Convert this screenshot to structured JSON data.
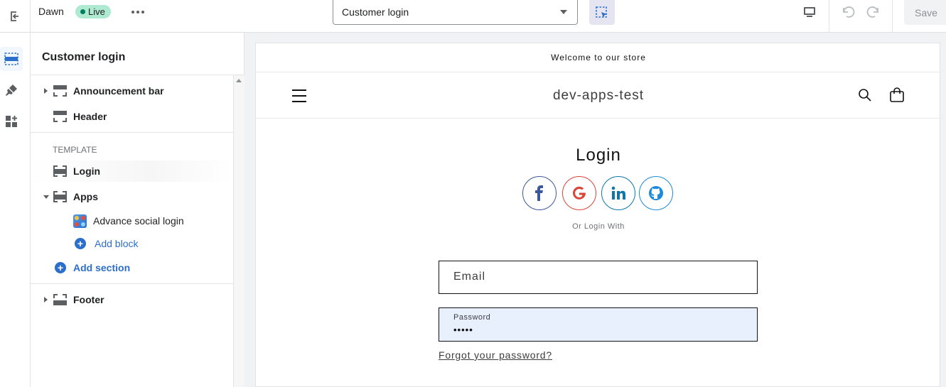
{
  "topbar": {
    "theme_name": "Dawn",
    "live_label": "Live",
    "page_select": "Customer login",
    "save_label": "Save"
  },
  "sidebar": {
    "title": "Customer login",
    "header_group": [
      {
        "label": "Announcement bar",
        "icon": "section-top-icon"
      },
      {
        "label": "Header",
        "icon": "section-top-icon"
      }
    ],
    "template_header": "TEMPLATE",
    "template_group": [
      {
        "label": "Login",
        "icon": "section-mid-icon"
      },
      {
        "label": "Apps",
        "icon": "section-mid-icon"
      }
    ],
    "app_block": "Advance social login",
    "add_block": "Add block",
    "add_section": "Add section",
    "footer_group": [
      {
        "label": "Footer",
        "icon": "section-bottom-icon"
      }
    ]
  },
  "preview": {
    "announcement": "Welcome to our store",
    "store_name": "dev-apps-test",
    "login_title": "Login",
    "social_buttons": [
      {
        "name": "facebook",
        "glyph": "f",
        "color": "#3b5998"
      },
      {
        "name": "google",
        "glyph": "G",
        "color": "#db4437"
      },
      {
        "name": "linkedin",
        "glyph": "in",
        "color": "#0e76a8"
      },
      {
        "name": "github",
        "glyph": "gh",
        "color": "#1c8adb"
      }
    ],
    "or_login_with": "Or Login With",
    "email_placeholder": "Email",
    "password_label": "Password",
    "password_value": "•••••",
    "forgot_password": "Forgot your password?"
  },
  "colors": {
    "accent": "#2c6ecb",
    "live_badge": "#aee9d1",
    "autofill": "#e8f0fe"
  }
}
